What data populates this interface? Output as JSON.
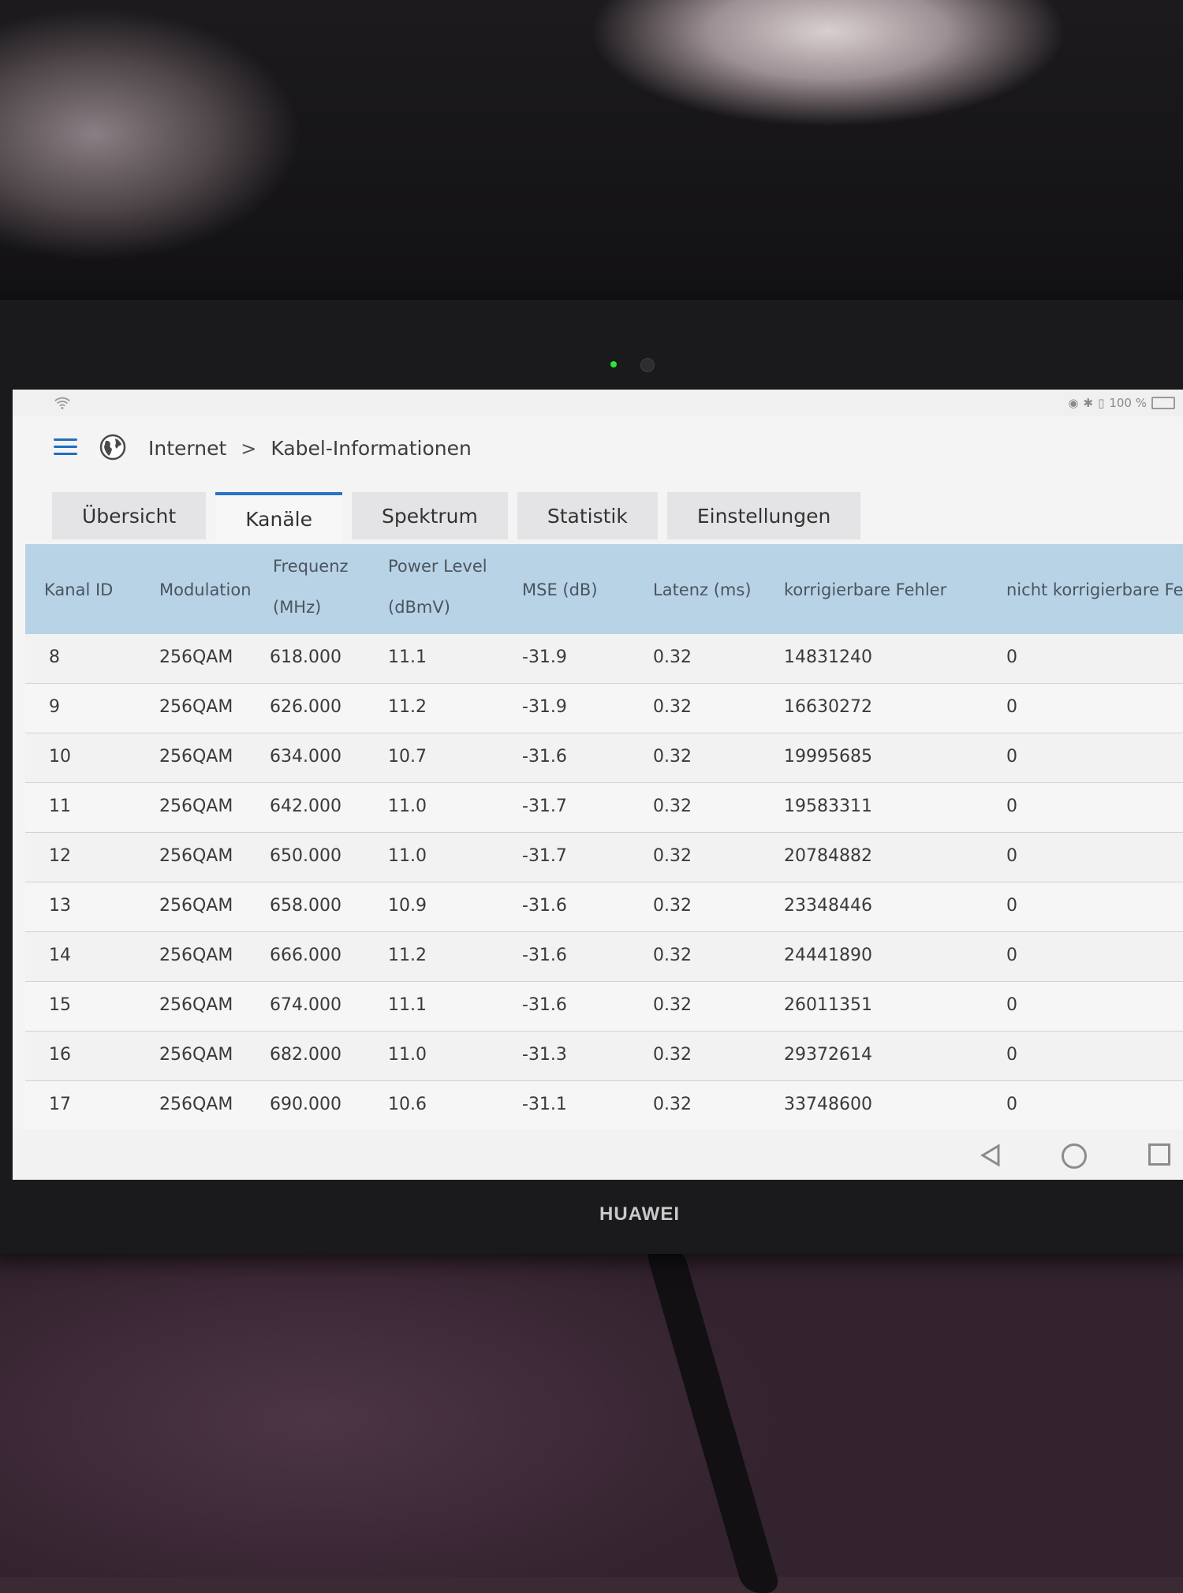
{
  "statusbar": {
    "battery": "100 %"
  },
  "header": {
    "breadcrumb": [
      "Internet",
      "Kabel-Informationen"
    ],
    "separator": ">"
  },
  "tabs": [
    {
      "label": "Übersicht",
      "active": false
    },
    {
      "label": "Kanäle",
      "active": true
    },
    {
      "label": "Spektrum",
      "active": false
    },
    {
      "label": "Statistik",
      "active": false
    },
    {
      "label": "Einstellungen",
      "active": false
    }
  ],
  "table": {
    "headers": {
      "kanal_id": "Kanal ID",
      "modulation": "Modulation",
      "frequenz": [
        "Frequenz",
        "(MHz)"
      ],
      "power": [
        "Power Level",
        "(dBmV)"
      ],
      "mse": "MSE (dB)",
      "latenz": "Latenz (ms)",
      "korr": "korrigierbare Fehler",
      "nicht_korr": "nicht korrigierbare Fe"
    },
    "rows": [
      {
        "id": "8",
        "mod": "256QAM",
        "freq": "618.000",
        "power": "11.1",
        "mse": "-31.9",
        "lat": "0.32",
        "korr": "14831240",
        "nkorr": "0"
      },
      {
        "id": "9",
        "mod": "256QAM",
        "freq": "626.000",
        "power": "11.2",
        "mse": "-31.9",
        "lat": "0.32",
        "korr": "16630272",
        "nkorr": "0"
      },
      {
        "id": "10",
        "mod": "256QAM",
        "freq": "634.000",
        "power": "10.7",
        "mse": "-31.6",
        "lat": "0.32",
        "korr": "19995685",
        "nkorr": "0"
      },
      {
        "id": "11",
        "mod": "256QAM",
        "freq": "642.000",
        "power": "11.0",
        "mse": "-31.7",
        "lat": "0.32",
        "korr": "19583311",
        "nkorr": "0"
      },
      {
        "id": "12",
        "mod": "256QAM",
        "freq": "650.000",
        "power": "11.0",
        "mse": "-31.7",
        "lat": "0.32",
        "korr": "20784882",
        "nkorr": "0"
      },
      {
        "id": "13",
        "mod": "256QAM",
        "freq": "658.000",
        "power": "10.9",
        "mse": "-31.6",
        "lat": "0.32",
        "korr": "23348446",
        "nkorr": "0"
      },
      {
        "id": "14",
        "mod": "256QAM",
        "freq": "666.000",
        "power": "11.2",
        "mse": "-31.6",
        "lat": "0.32",
        "korr": "24441890",
        "nkorr": "0"
      },
      {
        "id": "15",
        "mod": "256QAM",
        "freq": "674.000",
        "power": "11.1",
        "mse": "-31.6",
        "lat": "0.32",
        "korr": "26011351",
        "nkorr": "0"
      },
      {
        "id": "16",
        "mod": "256QAM",
        "freq": "682.000",
        "power": "11.0",
        "mse": "-31.3",
        "lat": "0.32",
        "korr": "29372614",
        "nkorr": "0"
      },
      {
        "id": "17",
        "mod": "256QAM",
        "freq": "690.000",
        "power": "10.6",
        "mse": "-31.1",
        "lat": "0.32",
        "korr": "33748600",
        "nkorr": "0"
      }
    ]
  },
  "device": {
    "brand": "HUAWEI"
  },
  "icons": {
    "menu": "menu-icon",
    "globe": "globe-icon",
    "back": "back-icon",
    "home": "home-icon",
    "recent": "recent-apps-icon"
  },
  "colors": {
    "accent": "#2a74c5",
    "table_header": "#b8d3e6"
  }
}
